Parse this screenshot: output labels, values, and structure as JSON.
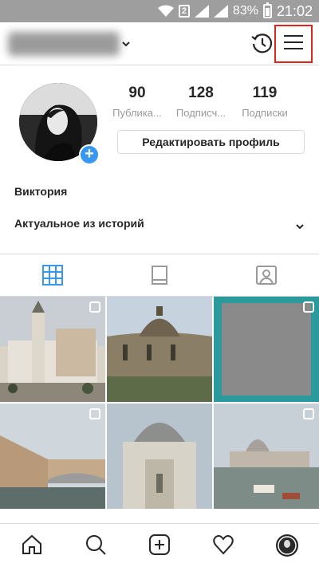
{
  "status_bar": {
    "sim_label": "2",
    "battery_percent": 83,
    "battery_text": "83%",
    "time": "21:02"
  },
  "header": {
    "username": "",
    "icons": [
      "chevron-down-icon",
      "history-icon",
      "hamburger-menu-icon"
    ],
    "menu_highlight_color": "#e2231a"
  },
  "profile": {
    "stats": [
      {
        "value": "90",
        "label": "Публика..."
      },
      {
        "value": "128",
        "label": "Подписч..."
      },
      {
        "value": "119",
        "label": "Подписки"
      }
    ],
    "edit_button_label": "Редактировать профиль",
    "display_name": "Виктория",
    "highlights_label": "Актуальное из историй",
    "add_badge_color": "#3897f0",
    "add_badge_symbol": "+"
  },
  "tabs": {
    "items": [
      "grid-icon",
      "feed-icon",
      "tagged-icon"
    ],
    "active": "grid-icon",
    "active_color": "#3897f0"
  },
  "bottom_nav": {
    "items": [
      "home-icon",
      "search-icon",
      "new-post-icon",
      "activity-heart-icon",
      "profile-avatar"
    ]
  }
}
